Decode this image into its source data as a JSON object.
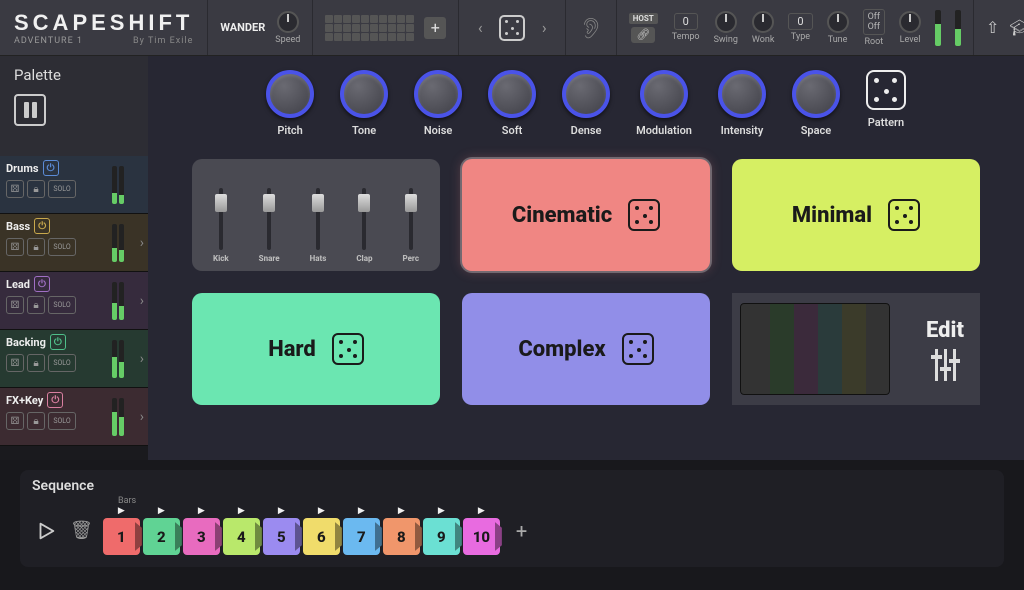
{
  "brand": {
    "title": "SCAPESHIFT",
    "preset": "ADVENTURE 1",
    "author": "By Tim Exile"
  },
  "topbar": {
    "mode": "WANDER",
    "speed_label": "Speed",
    "host": "HOST",
    "tempo": {
      "value": "0",
      "label": "Tempo"
    },
    "swing": {
      "value": "",
      "label": "Swing"
    },
    "wonk": {
      "value": "",
      "label": "Wonk"
    },
    "type": {
      "value": "0",
      "label": "Type"
    },
    "tune": {
      "value": "",
      "label": "Tune"
    },
    "root": {
      "off1": "Off",
      "off2": "Off",
      "label": "Root"
    },
    "level_label": "Level"
  },
  "palette": {
    "title": "Palette"
  },
  "tracks": [
    {
      "name": "Drums",
      "solo": "SOLO",
      "cls": "t-drums"
    },
    {
      "name": "Bass",
      "solo": "SOLO",
      "cls": "t-bass"
    },
    {
      "name": "Lead",
      "solo": "SOLO",
      "cls": "t-lead"
    },
    {
      "name": "Backing",
      "solo": "SOLO",
      "cls": "t-backing"
    },
    {
      "name": "FX+Key",
      "solo": "SOLO",
      "cls": "t-fx"
    }
  ],
  "knobs": [
    "Pitch",
    "Tone",
    "Noise",
    "Soft",
    "Dense",
    "Modulation",
    "Intensity",
    "Space"
  ],
  "pattern_label": "Pattern",
  "faders": [
    "Kick",
    "Snare",
    "Hats",
    "Clap",
    "Perc"
  ],
  "tiles": {
    "cinematic": "Cinematic",
    "minimal": "Minimal",
    "hard": "Hard",
    "complex": "Complex",
    "edit": "Edit"
  },
  "sequence": {
    "title": "Sequence",
    "bars": "Bars",
    "steps": [
      {
        "n": "1",
        "c": "c1"
      },
      {
        "n": "2",
        "c": "c2"
      },
      {
        "n": "3",
        "c": "c3"
      },
      {
        "n": "4",
        "c": "c4"
      },
      {
        "n": "5",
        "c": "c5"
      },
      {
        "n": "6",
        "c": "c6"
      },
      {
        "n": "7",
        "c": "c7"
      },
      {
        "n": "8",
        "c": "c8"
      },
      {
        "n": "9",
        "c": "c9"
      },
      {
        "n": "10",
        "c": "c10"
      }
    ]
  }
}
